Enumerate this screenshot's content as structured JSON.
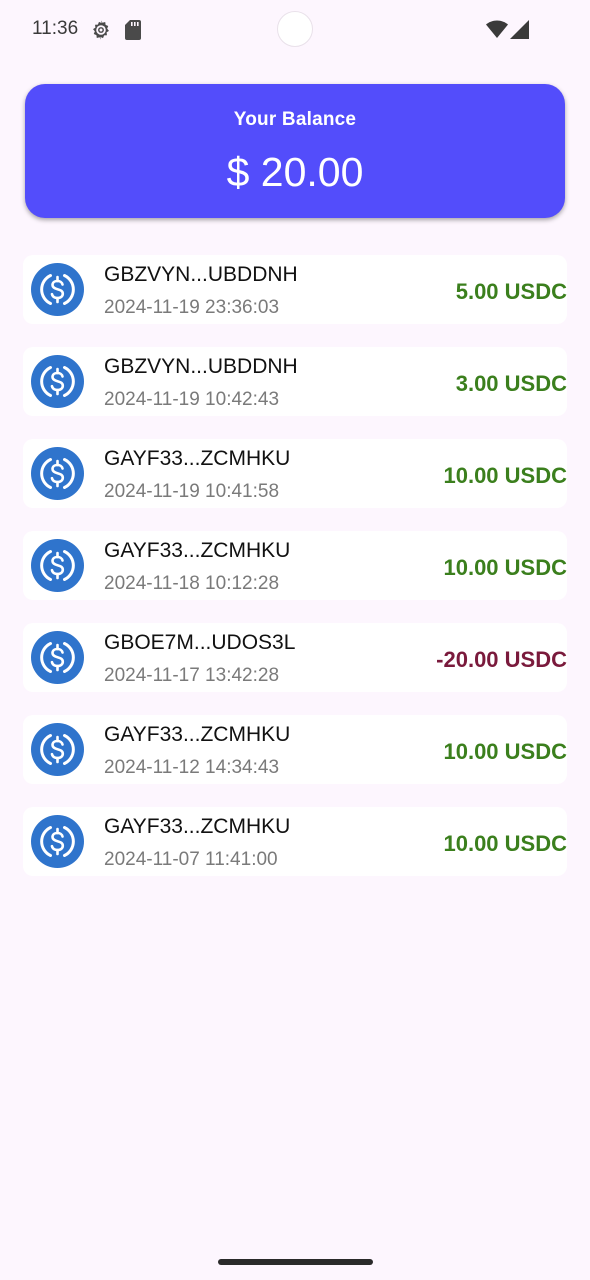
{
  "status_bar": {
    "time": "11:36",
    "icons": [
      "gear-icon",
      "sd-card-icon",
      "wifi-icon",
      "cell-signal-icon"
    ]
  },
  "balance": {
    "label": "Your Balance",
    "amount": "$ 20.00",
    "card_color": "#534dfb"
  },
  "colors": {
    "positive": "#3b7f1d",
    "negative": "#7a1a3c",
    "usdc_blue": "#2f74cc"
  },
  "transactions": [
    {
      "address": "GBZVYN...UBDDNH",
      "date": "2024-11-19 23:36:03",
      "amount": "5.00 USDC",
      "sign": "positive",
      "icon": "usdc-coin-icon"
    },
    {
      "address": "GBZVYN...UBDDNH",
      "date": "2024-11-19 10:42:43",
      "amount": "3.00 USDC",
      "sign": "positive",
      "icon": "usdc-coin-icon"
    },
    {
      "address": "GAYF33...ZCMHKU",
      "date": "2024-11-19 10:41:58",
      "amount": "10.00 USDC",
      "sign": "positive",
      "icon": "usdc-coin-icon"
    },
    {
      "address": "GAYF33...ZCMHKU",
      "date": "2024-11-18 10:12:28",
      "amount": "10.00 USDC",
      "sign": "positive",
      "icon": "usdc-coin-icon"
    },
    {
      "address": "GBOE7M...UDOS3L",
      "date": "2024-11-17 13:42:28",
      "amount": "-20.00 USDC",
      "sign": "negative",
      "icon": "usdc-coin-icon"
    },
    {
      "address": "GAYF33...ZCMHKU",
      "date": "2024-11-12 14:34:43",
      "amount": "10.00 USDC",
      "sign": "positive",
      "icon": "usdc-coin-icon"
    },
    {
      "address": "GAYF33...ZCMHKU",
      "date": "2024-11-07 11:41:00",
      "amount": "10.00 USDC",
      "sign": "positive",
      "icon": "usdc-coin-icon"
    }
  ]
}
